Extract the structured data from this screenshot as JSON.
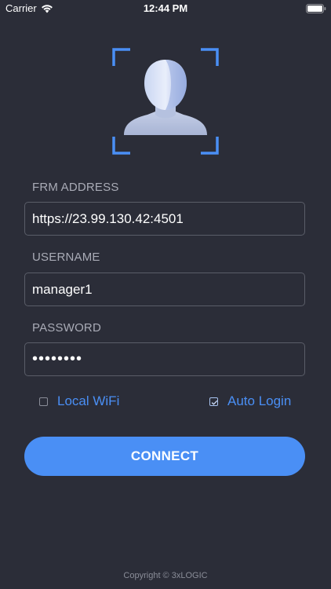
{
  "status_bar": {
    "carrier": "Carrier",
    "time": "12:44 PM"
  },
  "logo": {
    "icon": "face-scan-icon",
    "accent_color": "#4a8ff5"
  },
  "form": {
    "frm_address": {
      "label": "FRM ADDRESS",
      "value": "https://23.99.130.42:4501"
    },
    "username": {
      "label": "USERNAME",
      "value": "manager1"
    },
    "password": {
      "label": "PASSWORD",
      "value": "password"
    }
  },
  "options": {
    "local_wifi": {
      "label": "Local WiFi",
      "checked": false
    },
    "auto_login": {
      "label": "Auto Login",
      "checked": true
    }
  },
  "connect_button": {
    "label": "CONNECT"
  },
  "footer": {
    "copyright": "Copyright © 3xLOGIC"
  },
  "colors": {
    "background": "#2b2d38",
    "accent": "#4a8ff5",
    "label": "#a9abb6",
    "border": "#5a5d68"
  }
}
